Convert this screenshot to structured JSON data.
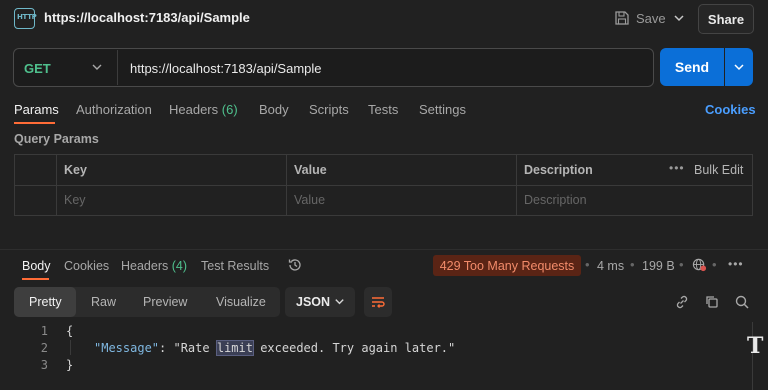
{
  "window": {
    "title": "https://localhost:7183/api/Sample",
    "icon_text": "HTTP"
  },
  "toolbar": {
    "save_label": "Save",
    "share_label": "Share"
  },
  "request": {
    "method": "GET",
    "url": "https://localhost:7183/api/Sample",
    "send_label": "Send"
  },
  "request_tabs": {
    "params": "Params",
    "authorization": "Authorization",
    "headers": "Headers",
    "headers_count": "(6)",
    "body": "Body",
    "scripts": "Scripts",
    "tests": "Tests",
    "settings": "Settings",
    "cookies": "Cookies"
  },
  "query_params": {
    "label": "Query Params",
    "columns": {
      "key": "Key",
      "value": "Value",
      "description": "Description"
    },
    "bulk_edit": "Bulk Edit",
    "placeholders": {
      "key": "Key",
      "value": "Value",
      "description": "Description"
    }
  },
  "response_tabs": {
    "body": "Body",
    "cookies": "Cookies",
    "headers": "Headers",
    "headers_count": "(4)",
    "test_results": "Test Results"
  },
  "response_meta": {
    "status": "429 Too Many Requests",
    "time": "4 ms",
    "size": "199 B"
  },
  "format": {
    "pretty": "Pretty",
    "raw": "Raw",
    "preview": "Preview",
    "visualize": "Visualize",
    "language": "JSON"
  },
  "code": {
    "line_numbers": [
      "1",
      "2",
      "3"
    ],
    "open_brace": "{",
    "key": "\"Message\"",
    "colon": ": ",
    "value_before": "\"Rate ",
    "value_highlight": "limit",
    "value_after": " exceeded. Try again later.\"",
    "close_brace": "}"
  },
  "colors": {
    "accent": "#ff6c37",
    "send": "#0b6fd8",
    "method_get": "#4fc08d",
    "status_error": "#f28b6a",
    "link": "#4a9eff"
  }
}
